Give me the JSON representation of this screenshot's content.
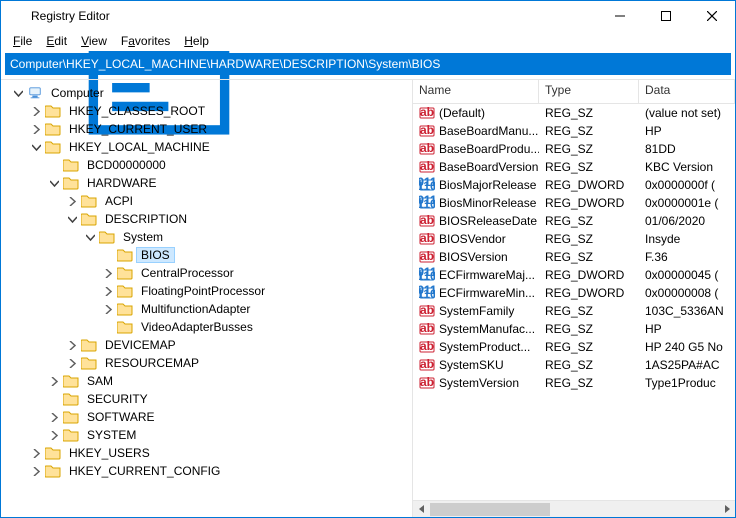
{
  "window": {
    "title": "Registry Editor"
  },
  "menu": {
    "file": "File",
    "edit": "Edit",
    "view": "View",
    "favorites": "Favorites",
    "help": "Help"
  },
  "address": "Computer\\HKEY_LOCAL_MACHINE\\HARDWARE\\DESCRIPTION\\System\\BIOS",
  "tree": {
    "root": "Computer",
    "hkcr": "HKEY_CLASSES_ROOT",
    "hkcu": "HKEY_CURRENT_USER",
    "hklm": "HKEY_LOCAL_MACHINE",
    "bcd": "BCD00000000",
    "hardware": "HARDWARE",
    "acpi": "ACPI",
    "description": "DESCRIPTION",
    "system": "System",
    "bios": "BIOS",
    "centralprocessor": "CentralProcessor",
    "floatingpoint": "FloatingPointProcessor",
    "multifunction": "MultifunctionAdapter",
    "videoadapter": "VideoAdapterBusses",
    "devicemap": "DEVICEMAP",
    "resourcemap": "RESOURCEMAP",
    "sam": "SAM",
    "security": "SECURITY",
    "software": "SOFTWARE",
    "systemkey": "SYSTEM",
    "hku": "HKEY_USERS",
    "hkcc": "HKEY_CURRENT_CONFIG"
  },
  "columns": {
    "name": "Name",
    "type": "Type",
    "data": "Data"
  },
  "values": [
    {
      "icon": "sz",
      "name": "(Default)",
      "type": "REG_SZ",
      "data": "(value not set)"
    },
    {
      "icon": "sz",
      "name": "BaseBoardManu...",
      "type": "REG_SZ",
      "data": "HP"
    },
    {
      "icon": "sz",
      "name": "BaseBoardProdu...",
      "type": "REG_SZ",
      "data": "81DD"
    },
    {
      "icon": "sz",
      "name": "BaseBoardVersion",
      "type": "REG_SZ",
      "data": "KBC Version "
    },
    {
      "icon": "dw",
      "name": "BiosMajorRelease",
      "type": "REG_DWORD",
      "data": "0x0000000f ("
    },
    {
      "icon": "dw",
      "name": "BiosMinorRelease",
      "type": "REG_DWORD",
      "data": "0x0000001e ("
    },
    {
      "icon": "sz",
      "name": "BIOSReleaseDate",
      "type": "REG_SZ",
      "data": "01/06/2020"
    },
    {
      "icon": "sz",
      "name": "BIOSVendor",
      "type": "REG_SZ",
      "data": "Insyde"
    },
    {
      "icon": "sz",
      "name": "BIOSVersion",
      "type": "REG_SZ",
      "data": "F.36"
    },
    {
      "icon": "dw",
      "name": "ECFirmwareMaj...",
      "type": "REG_DWORD",
      "data": "0x00000045 ("
    },
    {
      "icon": "dw",
      "name": "ECFirmwareMin...",
      "type": "REG_DWORD",
      "data": "0x00000008 ("
    },
    {
      "icon": "sz",
      "name": "SystemFamily",
      "type": "REG_SZ",
      "data": "103C_5336AN"
    },
    {
      "icon": "sz",
      "name": "SystemManufac...",
      "type": "REG_SZ",
      "data": "HP"
    },
    {
      "icon": "sz",
      "name": "SystemProduct...",
      "type": "REG_SZ",
      "data": "HP 240 G5 No"
    },
    {
      "icon": "sz",
      "name": "SystemSKU",
      "type": "REG_SZ",
      "data": "1AS25PA#AC"
    },
    {
      "icon": "sz",
      "name": "SystemVersion",
      "type": "REG_SZ",
      "data": "Type1Produc"
    }
  ]
}
